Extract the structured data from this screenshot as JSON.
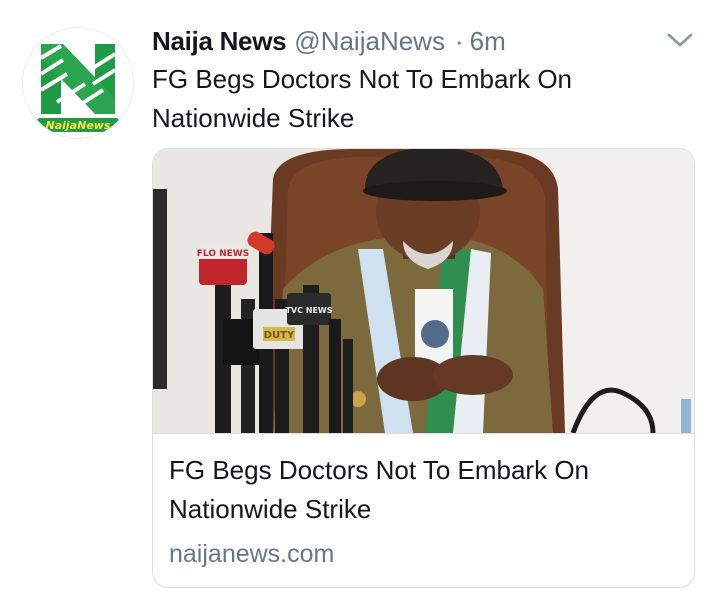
{
  "tweet": {
    "author_name": "Naija News",
    "handle": "@NaijaNews",
    "separator": "·",
    "time": "6m",
    "text_lines": [
      "FG Begs Doctors Not To Embark On",
      "Nationwide Strike"
    ],
    "avatar_label": "NaijaNews"
  },
  "card": {
    "title_lines": [
      "FG Begs Doctors Not To Embark On",
      "Nationwide Strike"
    ],
    "domain": "naijanews.com",
    "mic_flags": {
      "flo": "FLO NEWS",
      "duty": "DUTY",
      "tvc": "TVC NEWS"
    }
  },
  "icons": {
    "menu": "chevron-down-icon"
  },
  "colors": {
    "accent_green": "#1f9a45",
    "text_primary": "#14171a",
    "text_secondary": "#657786",
    "border": "#d9e1e7"
  }
}
